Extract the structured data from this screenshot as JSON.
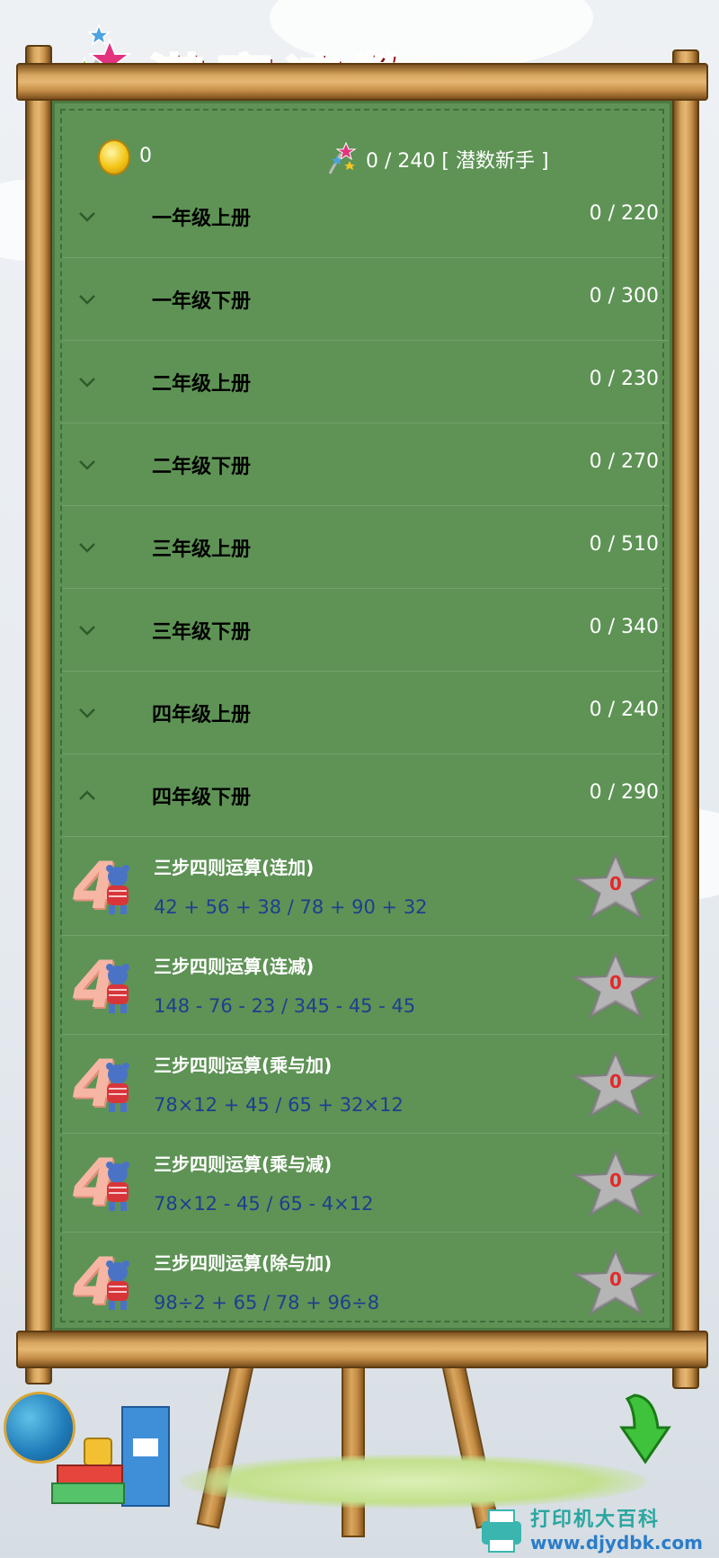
{
  "app": {
    "title": "潜赛速数"
  },
  "header": {
    "coins": "0",
    "progress": "0 / 240 [ 潜数新手 ]"
  },
  "grades": [
    {
      "label": "一年级上册",
      "count": "0 / 220",
      "expanded": false
    },
    {
      "label": "一年级下册",
      "count": "0 / 300",
      "expanded": false
    },
    {
      "label": "二年级上册",
      "count": "0 / 230",
      "expanded": false
    },
    {
      "label": "二年级下册",
      "count": "0 / 270",
      "expanded": false
    },
    {
      "label": "三年级上册",
      "count": "0 / 510",
      "expanded": false
    },
    {
      "label": "三年级下册",
      "count": "0 / 340",
      "expanded": false
    },
    {
      "label": "四年级上册",
      "count": "0 / 240",
      "expanded": false
    },
    {
      "label": "四年级下册",
      "count": "0 / 290",
      "expanded": true
    }
  ],
  "lessons": [
    {
      "title": "三步四则运算(连加)",
      "expr": "42 + 56 + 38 / 78 + 90 + 32",
      "stars": "0",
      "grade_num": "4"
    },
    {
      "title": "三步四则运算(连减)",
      "expr": "148 - 76 - 23 / 345 - 45 - 45",
      "stars": "0",
      "grade_num": "4"
    },
    {
      "title": "三步四则运算(乘与加)",
      "expr": "78×12 + 45 / 65 + 32×12",
      "stars": "0",
      "grade_num": "4"
    },
    {
      "title": "三步四则运算(乘与减)",
      "expr": "78×12 - 45 / 65 - 4×12",
      "stars": "0",
      "grade_num": "4"
    },
    {
      "title": "三步四则运算(除与加)",
      "expr": "98÷2 + 65 / 78 + 96÷8",
      "stars": "0",
      "grade_num": "4"
    }
  ],
  "watermark": {
    "line1": "打印机大百科",
    "line2": "www.djydbk.com"
  },
  "colors": {
    "board": "#5e9355",
    "title": "#f01e2e",
    "expr": "#1c3f8f",
    "star_count": "#e22a2a"
  }
}
